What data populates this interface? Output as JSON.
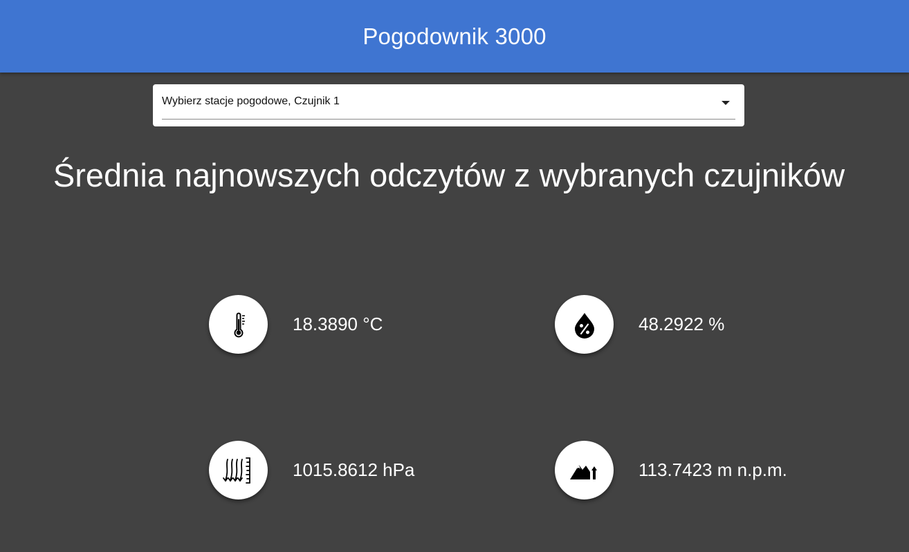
{
  "header": {
    "title": "Pogodownik 3000",
    "bar_color": "#3f75d1"
  },
  "station_select": {
    "value": "Wybierz stacje pogodowe, Czujnik 1",
    "icon": "arrow-drop-down-icon"
  },
  "section": {
    "title": "Średnia najnowszych odczytów z wybranych czujników"
  },
  "readings": {
    "temperature": {
      "icon": "thermometer-icon",
      "value": "18.3890 °C"
    },
    "humidity": {
      "icon": "humidity-drop-icon",
      "value": "48.2922 %"
    },
    "pressure": {
      "icon": "pressure-icon",
      "value": "1015.8612 hPa"
    },
    "altitude": {
      "icon": "mountain-altitude-icon",
      "value": "113.7423 m n.p.m."
    }
  }
}
